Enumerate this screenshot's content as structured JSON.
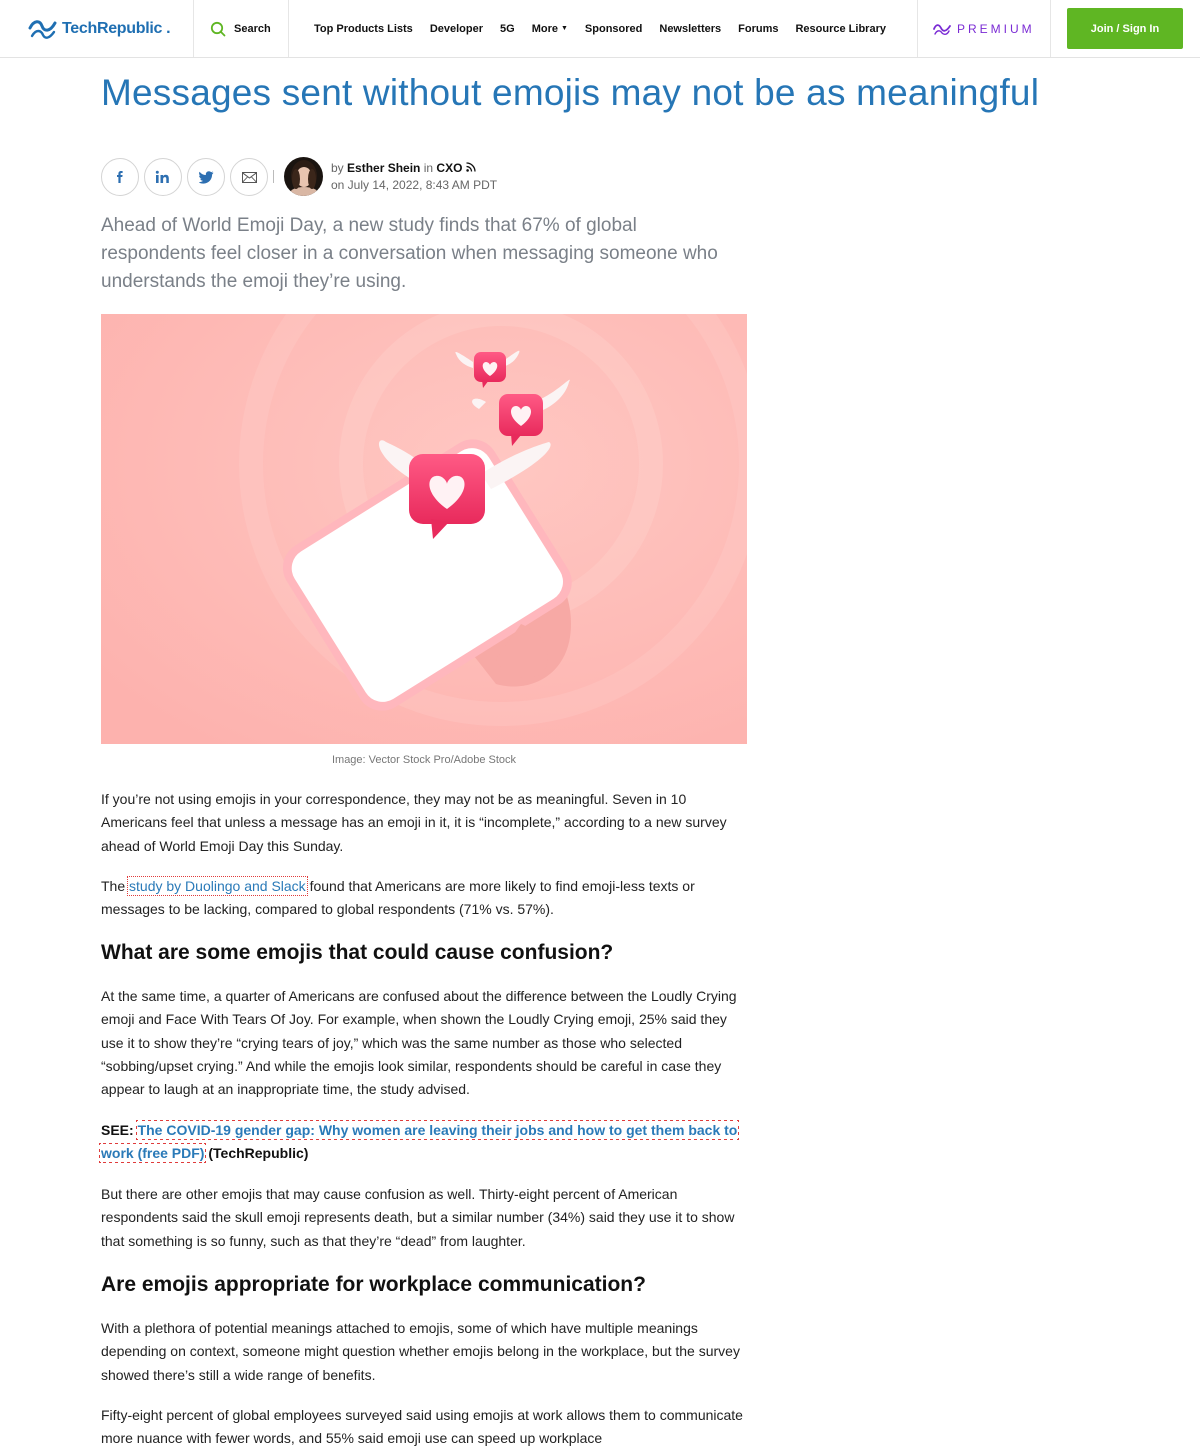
{
  "header": {
    "logo_text": "TechRepublic",
    "logo_mark": ".",
    "search_label": "Search",
    "nav": [
      {
        "label": "Top Products Lists"
      },
      {
        "label": "Developer"
      },
      {
        "label": "5G"
      },
      {
        "label": "More"
      },
      {
        "label": "Sponsored"
      },
      {
        "label": "Newsletters"
      },
      {
        "label": "Forums"
      },
      {
        "label": "Resource Library"
      }
    ],
    "premium_label": "PREMIUM",
    "join_label": "Join / Sign In",
    "brand_color": "#1f6fb2",
    "premium_color": "#7a2bd4",
    "join_color": "#5fb623"
  },
  "article": {
    "title": "Messages sent without emojis may not be as meaningful",
    "byline": {
      "by": "by",
      "author": "Esther Shein",
      "in": "in",
      "category": "CXO",
      "date": "on July 14, 2022, 8:43 AM PDT"
    },
    "share_icons": [
      "facebook-icon",
      "linkedin-icon",
      "twitter-icon",
      "email-icon"
    ],
    "dek": "Ahead of World Emoji Day, a new study finds that 67% of global respondents feel closer in a conversation when messaging someone who understands the emoji they’re using.",
    "image_caption": "Image: Vector Stock Pro/Adobe Stock",
    "p1": "If you’re not using emojis in your correspondence, they may not be as meaningful. Seven in 10 Americans feel that unless a message has an emoji in it, it is “incomplete,” according to a new survey ahead of World Emoji Day this Sunday.",
    "p2_pre": "The ",
    "p2_link": "study by Duolingo and Slack",
    "p2_post": " found that Americans are more likely to find emoji-less texts or messages to be lacking, compared to global respondents (71% vs. 57%).",
    "h2_1": "What are some emojis that could cause confusion?",
    "p3": "At the same time, a quarter of Americans are confused about the difference between the Loudly Crying emoji and Face With Tears Of Joy. For example, when shown the Loudly Crying emoji, 25% said they use it to show they’re “crying tears of joy,” which was the same number as those who selected “sobbing/upset crying.” And while the emojis look similar, respondents should be careful in case they appear to laugh at an inappropriate time, the study advised.",
    "see_label": "SEE:",
    "see_link": "The COVID-19 gender gap: Why women are leaving their jobs and how to get them back to work (free PDF)",
    "see_tail": " (TechRepublic)",
    "p4": "But there are other emojis that may cause confusion as well. Thirty-eight percent of American respondents said the skull emoji represents death, but a similar number (34%) said they use it to show that something is so funny, such as that they’re “dead” from laughter.",
    "h2_2": "Are emojis appropriate for workplace communication?",
    "p5": "With a plethora of potential meanings attached to emojis, some of which have multiple meanings depending on context, someone might question whether emojis belong in the workplace, but the survey showed there’s still a wide range of benefits.",
    "p6": "Fifty-eight percent of global employees surveyed said using emojis at work allows them to communicate more nuance with fewer words, and 55% said emoji use can speed up workplace"
  }
}
